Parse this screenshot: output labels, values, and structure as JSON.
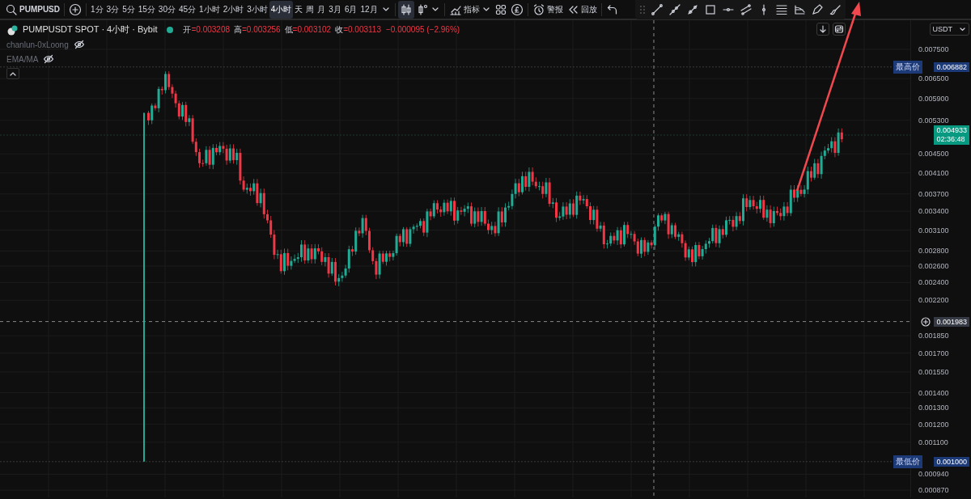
{
  "toolbar": {
    "symbol": "PUMPUSD",
    "intervals": [
      {
        "label": "1分",
        "selected": false
      },
      {
        "label": "3分",
        "selected": false
      },
      {
        "label": "5分",
        "selected": false
      },
      {
        "label": "15分",
        "selected": false
      },
      {
        "label": "30分",
        "selected": false
      },
      {
        "label": "45分",
        "selected": false
      },
      {
        "label": "1小时",
        "selected": false
      },
      {
        "label": "2小时",
        "selected": false
      },
      {
        "label": "3小时",
        "selected": false
      },
      {
        "label": "4小时",
        "selected": true
      },
      {
        "label": "天",
        "selected": false
      },
      {
        "label": "周",
        "selected": false
      },
      {
        "label": "月",
        "selected": false
      },
      {
        "label": "3月",
        "selected": false
      },
      {
        "label": "6月",
        "selected": false
      },
      {
        "label": "12月",
        "selected": false
      }
    ],
    "indicators_label": "指标",
    "alert_label": "警报",
    "replay_label": "回放"
  },
  "legend": {
    "title": "PUMPUSDT SPOT · 4小时 · Bybit",
    "ohlc": [
      {
        "label": "开",
        "value": "=0.003208"
      },
      {
        "label": "高",
        "value": "=0.003256"
      },
      {
        "label": "低",
        "value": "=0.003102"
      },
      {
        "label": "收",
        "value": "=0.003113"
      }
    ],
    "change": "−0.000095 (−2.96%)",
    "indicators": [
      {
        "name": "chanlun-0xLoong"
      },
      {
        "name": "EMA/MA"
      }
    ]
  },
  "currency": "USDT",
  "price_axis": {
    "ticks": [
      "0.007500",
      "0.006500",
      "0.005900",
      "0.005300",
      "0.004500",
      "0.004100",
      "0.003700",
      "0.003400",
      "0.003100",
      "0.002800",
      "0.002600",
      "0.002400",
      "0.002200",
      "0.001850",
      "0.001700",
      "0.001550",
      "0.001400",
      "0.001300",
      "0.001200",
      "0.001100",
      "0.000940",
      "0.000870"
    ],
    "markers": [
      {
        "kind": "high",
        "tag": "最高价",
        "price": "0.006882"
      },
      {
        "kind": "last",
        "price": "0.004933",
        "countdown": "02:36:48"
      },
      {
        "kind": "crosshair",
        "price": "0.001983"
      },
      {
        "kind": "low",
        "tag": "最低价",
        "price": "0.001000"
      }
    ]
  }
}
